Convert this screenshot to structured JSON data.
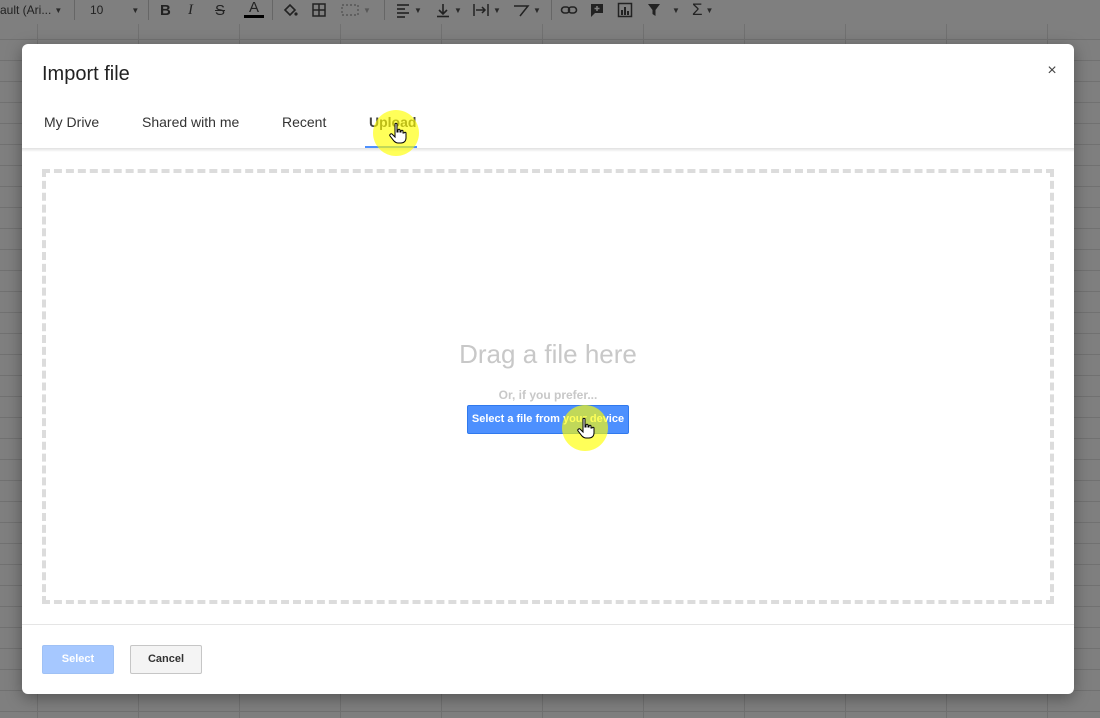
{
  "toolbar": {
    "font_name": "ault (Ari...",
    "font_size": "10",
    "icons": [
      "bold-icon",
      "italic-icon",
      "strikethrough-icon",
      "text-color-icon",
      "fill-color-icon",
      "borders-icon",
      "merge-cells-icon",
      "align-icon",
      "valign-icon",
      "text-wrap-icon",
      "text-rotate-icon",
      "link-icon",
      "comment-icon",
      "chart-icon",
      "filter-icon",
      "functions-icon"
    ],
    "text_color_swatch": "#000000"
  },
  "dialog": {
    "title": "Import file",
    "close_glyph": "×",
    "tabs": [
      {
        "label": "My Drive",
        "active": false
      },
      {
        "label": "Shared with me",
        "active": false
      },
      {
        "label": "Recent",
        "active": false
      },
      {
        "label": "Upload",
        "active": true
      }
    ],
    "dropzone": {
      "title": "Drag a file here",
      "subtitle": "Or, if you prefer...",
      "button_label": "Select a file from your device"
    },
    "footer": {
      "select_label": "Select",
      "cancel_label": "Cancel"
    }
  },
  "colors": {
    "accent": "#4d90fe",
    "accent_disabled": "#a6c8ff",
    "highlight": "#ffff00"
  }
}
